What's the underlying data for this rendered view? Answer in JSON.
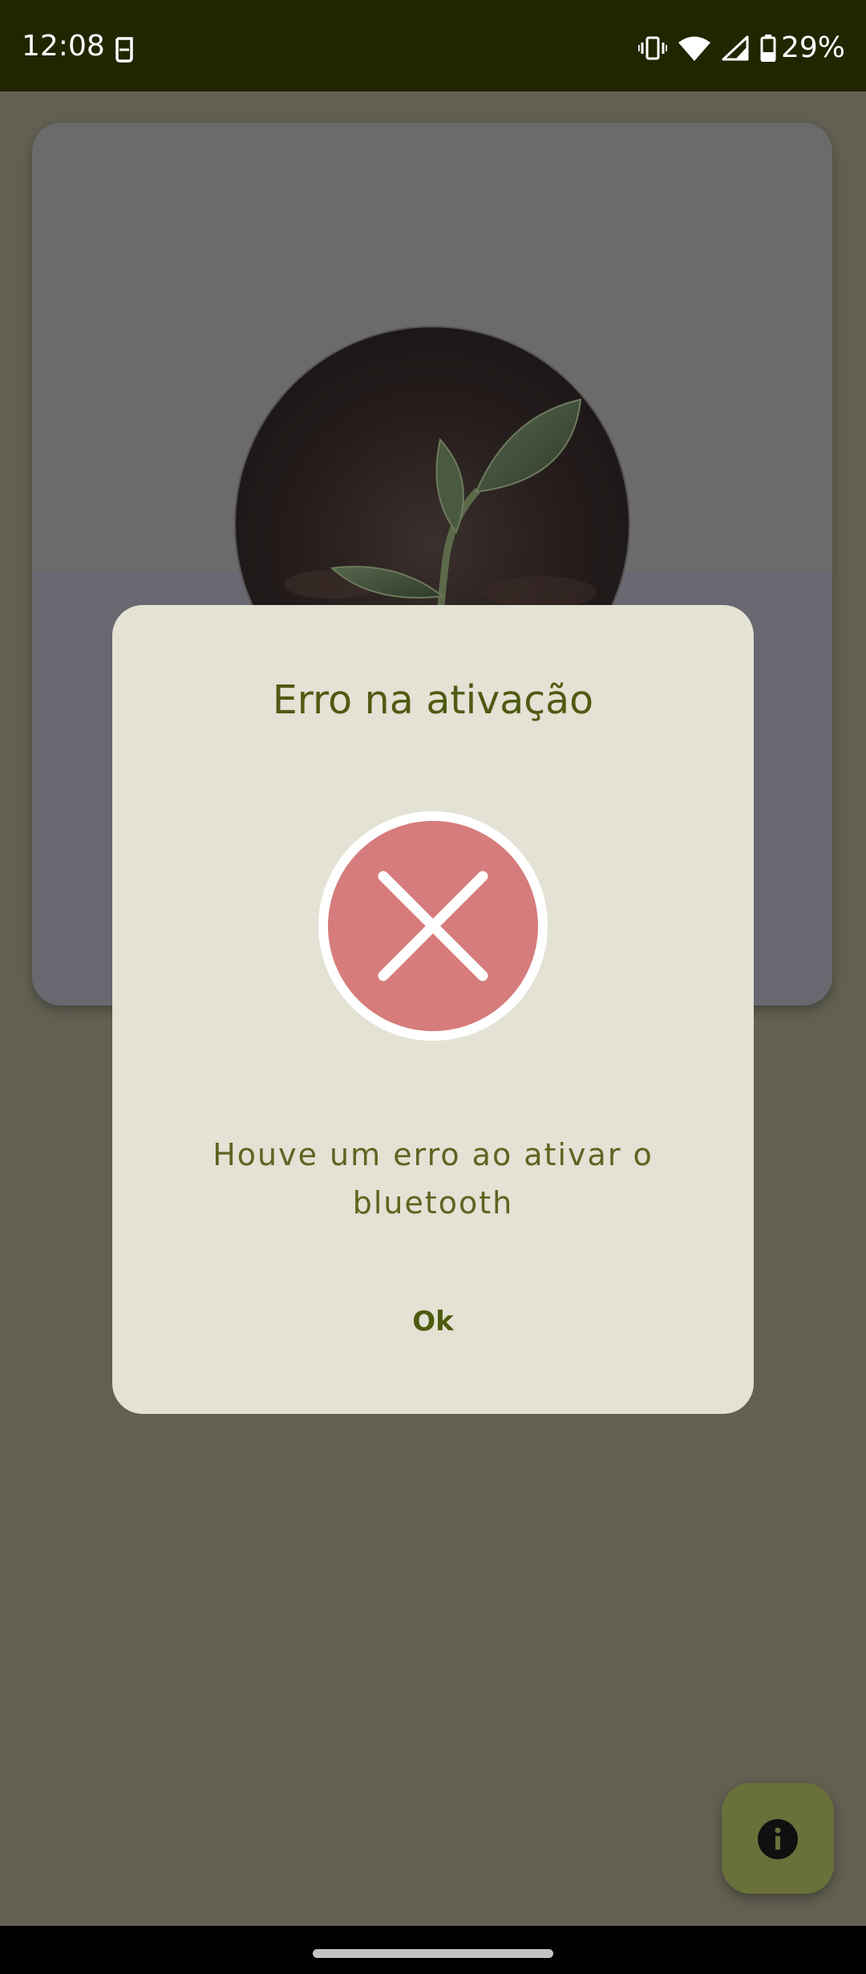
{
  "status_bar": {
    "time": "12:08",
    "battery": "29%",
    "icons": [
      "sim-tray-icon",
      "vibrate-icon",
      "wifi-icon",
      "signal-icon",
      "battery-icon"
    ]
  },
  "background_card": {
    "image": "plant-seedling-photo"
  },
  "dialog": {
    "title": "Erro na ativação",
    "icon": "error-x-icon",
    "message": "Houve um erro ao ativar o bluetooth",
    "ok_label": "Ok"
  },
  "fab": {
    "icon": "info-icon"
  },
  "colors": {
    "status_bar_bg": "#212601",
    "scrim": "#616052",
    "dialog_bg": "#e3e2d4",
    "title_text": "#505a12",
    "error_red": "#d67c7c",
    "fab_bg": "#6a7039"
  }
}
